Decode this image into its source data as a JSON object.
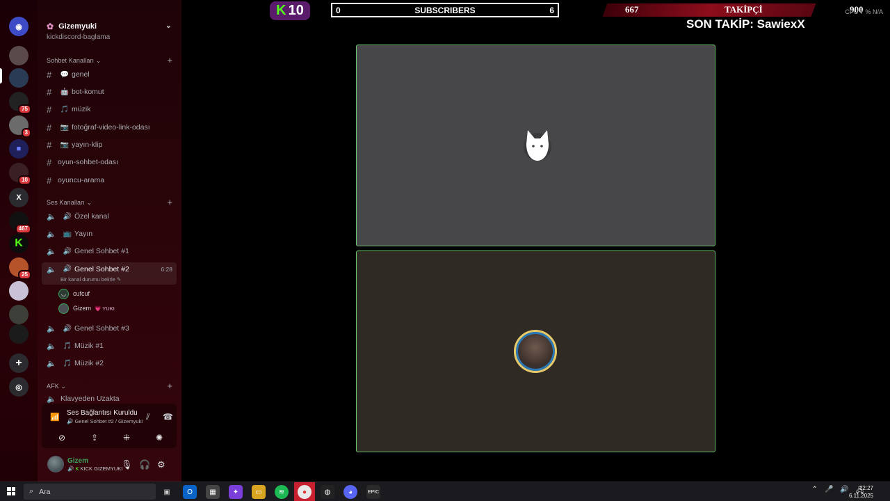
{
  "server": {
    "name": "Gizemyuki",
    "cut_channel": "kickdiscord-baglama"
  },
  "categories": {
    "chat": "Sohbet Kanalları",
    "voice": "Ses Kanalları",
    "afk": "AFK"
  },
  "text_channels": [
    {
      "name": "genel",
      "icon": "💬"
    },
    {
      "name": "bot-komut",
      "icon": "🤖"
    },
    {
      "name": "müzik",
      "icon": "🎵"
    },
    {
      "name": "fotoğraf-video-link-odası",
      "icon": "📷"
    },
    {
      "name": "yayın-klip",
      "icon": "📷"
    },
    {
      "name": "oyun-sohbet-odası",
      "icon": ""
    },
    {
      "name": "oyuncu-arama",
      "icon": ""
    }
  ],
  "voice_channels": [
    {
      "name": "Özel kanal",
      "icon": "🔊"
    },
    {
      "name": "Yayın",
      "icon": "📺"
    },
    {
      "name": "Genel Sohbet #1",
      "icon": "🔊"
    }
  ],
  "active_voice": {
    "name": "Genel Sohbet #2",
    "time": "6:28",
    "status_hint": "Bir kanal durumu belirle",
    "members": [
      {
        "name": "cufcuf",
        "tag": ""
      },
      {
        "name": "Gizem",
        "tag": "💗 YUKI"
      }
    ]
  },
  "more_voice_channels": [
    {
      "name": "Genel Sohbet #3",
      "icon": "🔊"
    },
    {
      "name": "Müzik #1",
      "icon": "🎵"
    },
    {
      "name": "Müzik #2",
      "icon": "🎵"
    }
  ],
  "afk_channel": "Klavyeden Uzakta",
  "voice_panel": {
    "status": "Ses Bağlantısı Kuruldu",
    "location": "Genel Sohbet #2 / Gizemyuki"
  },
  "user": {
    "name": "Gizem",
    "sub": "KICK GIZEMYUKI"
  },
  "rail_badges": {
    "b1": "75",
    "b2": "3",
    "b3": "10",
    "b4": "467",
    "b5": "25"
  },
  "rail_letter": "X",
  "overlay": {
    "kick_count": "10",
    "subs_left": "0",
    "subs_label": "SUBSCRIBERS",
    "subs_right": "6",
    "followers_current": "667",
    "followers_label": "TAKİPÇİ",
    "followers_goal": "900",
    "last_follow": "SON TAKİP: SawiexX",
    "cpu_label": "CPU",
    "cpu_value": "7 %",
    "na_value": "N/A"
  },
  "taskbar": {
    "search_placeholder": "Ara",
    "time": "22:27",
    "date": "6.11.2025"
  },
  "colors": {
    "speaking_border": "#6ac46a",
    "accent_red": "#8d0d1c",
    "kick_green": "#53fc18"
  }
}
